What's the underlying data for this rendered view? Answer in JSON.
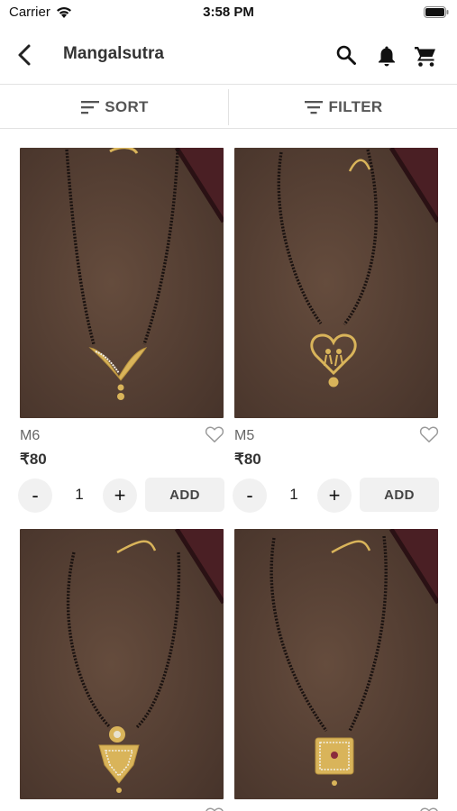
{
  "status_bar": {
    "carrier": "Carrier",
    "time": "3:58 PM",
    "wifi_icon": "wifi-icon",
    "battery_icon": "battery-icon"
  },
  "app_bar": {
    "title": "Mangalsutra",
    "back_icon": "back-icon",
    "search_icon": "search-icon",
    "bell_icon": "bell-icon",
    "cart_icon": "cart-icon"
  },
  "toolbar": {
    "sort_label": "SORT",
    "filter_label": "FILTER"
  },
  "products": [
    {
      "name": "M6",
      "price": "₹80",
      "quantity": "1",
      "minus_label": "-",
      "plus_label": "+",
      "add_label": "ADD",
      "pendant": "v-shape"
    },
    {
      "name": "M5",
      "price": "₹80",
      "quantity": "1",
      "minus_label": "-",
      "plus_label": "+",
      "add_label": "ADD",
      "pendant": "heart"
    },
    {
      "name": "",
      "price": "",
      "quantity": "",
      "minus_label": "",
      "plus_label": "",
      "add_label": "",
      "pendant": "shield"
    },
    {
      "name": "",
      "price": "",
      "quantity": "",
      "minus_label": "",
      "plus_label": "",
      "add_label": "",
      "pendant": "square"
    }
  ],
  "colors": {
    "background_fabric": "#553f32",
    "beads": "#1a1210",
    "gold": "#d9b45a",
    "burgundy": "#4a1f24"
  }
}
